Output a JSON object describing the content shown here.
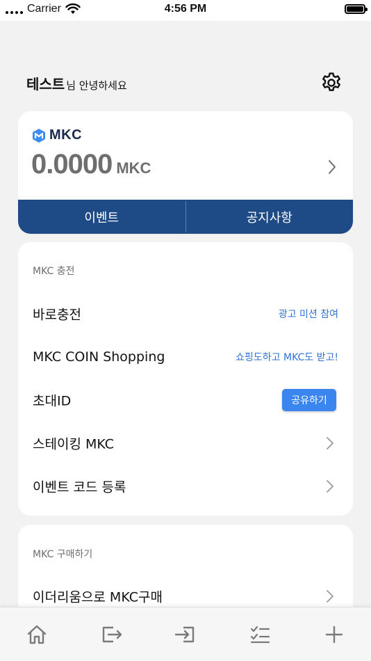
{
  "status_bar": {
    "carrier": "Carrier",
    "time": "4:56 PM"
  },
  "greeting": {
    "name": "테스트",
    "suffix": "님 안녕하세요"
  },
  "wallet": {
    "brand": "MKC",
    "balance": "0.0000",
    "unit": "MKC",
    "tabs": [
      "이벤트",
      "공지사항"
    ]
  },
  "recharge": {
    "title": "MKC 충전",
    "items": [
      {
        "label": "바로충전",
        "link": "광고 미션 참여"
      },
      {
        "label": "MKC COIN Shopping",
        "link": "쇼핑도하고 MKC도 받고!"
      },
      {
        "label": "초대ID",
        "button": "공유하기"
      },
      {
        "label": "스테이킹 MKC"
      },
      {
        "label": "이벤트 코드 등록"
      }
    ]
  },
  "purchase": {
    "title": "MKC 구매하기",
    "items": [
      {
        "label": "이더리움으로 MKC구매"
      }
    ]
  },
  "colors": {
    "accent_navy": "#1e4a86",
    "link_blue": "#2f72d6",
    "share_button": "#3b86ee",
    "background": "#f2f2f2"
  },
  "icons": {
    "settings": "gear-icon",
    "nav": [
      "home-icon",
      "send-icon",
      "receive-icon",
      "checklist-icon",
      "plus-icon"
    ]
  }
}
